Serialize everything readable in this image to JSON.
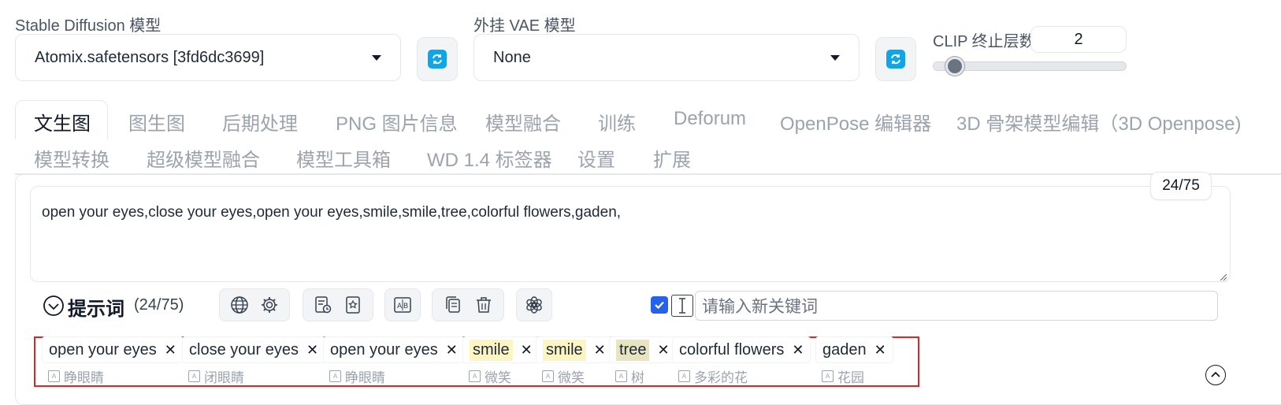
{
  "model": {
    "label": "Stable Diffusion 模型",
    "value": "Atomix.safetensors [3fd6dc3699]"
  },
  "vae": {
    "label": "外挂 VAE 模型",
    "value": "None"
  },
  "clip": {
    "label": "CLIP 终止层数",
    "value": "2",
    "slider_fraction": 0.07
  },
  "tabs_row1": [
    "文生图",
    "图生图",
    "后期处理",
    "PNG 图片信息",
    "模型融合",
    "训练",
    "Deforum",
    "OpenPose 编辑器",
    "3D 骨架模型编辑（3D Openpose)"
  ],
  "tabs_row2": [
    "模型转换",
    "超级模型融合",
    "模型工具箱",
    "WD 1.4 标签器",
    "设置",
    "扩展"
  ],
  "prompt": {
    "text": "open your eyes,close your eyes,open your eyes,smile,smile,tree,colorful flowers,gaden,",
    "counter": "24/75"
  },
  "toolbar": {
    "title": "提示词",
    "count": "(24/75)",
    "keyword_placeholder": "请输入新关键词",
    "checkbox_checked": true
  },
  "tags": [
    {
      "text": "open your eyes",
      "trans": "睁眼睛",
      "hl": ""
    },
    {
      "text": "close your eyes",
      "trans": "闭眼睛",
      "hl": ""
    },
    {
      "text": "open your eyes",
      "trans": "睁眼睛",
      "hl": ""
    },
    {
      "text": "smile",
      "trans": "微笑",
      "hl": "yellow"
    },
    {
      "text": "smile",
      "trans": "微笑",
      "hl": "yellow"
    },
    {
      "text": "tree",
      "trans": "树",
      "hl": "olive"
    },
    {
      "text": "colorful flowers",
      "trans": "多彩的花",
      "hl": ""
    },
    {
      "text": "gaden",
      "trans": "花园",
      "hl": ""
    }
  ],
  "colors": {
    "accent": "#2563eb",
    "refresh": "#0ea5e9",
    "highlight_border": "#dc2626"
  }
}
